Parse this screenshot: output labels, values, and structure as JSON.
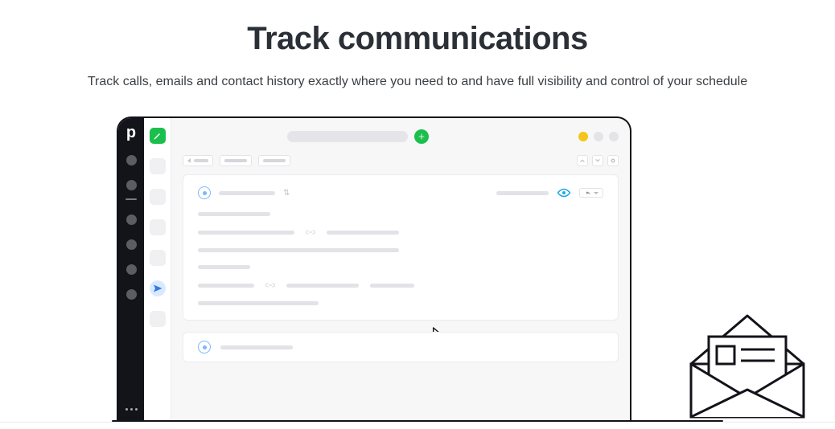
{
  "hero": {
    "title": "Track communications",
    "subtitle": "Track calls, emails and contact history exactly where you need to and have full visibility and control of your schedule"
  },
  "sidebar": {
    "logo_letter": "p"
  },
  "topbar": {
    "add_glyph": "+"
  },
  "icons": {
    "pencil": "pencil",
    "send": "send",
    "eye": "eye",
    "reply": "reply",
    "link": "link",
    "gear": "gear"
  }
}
